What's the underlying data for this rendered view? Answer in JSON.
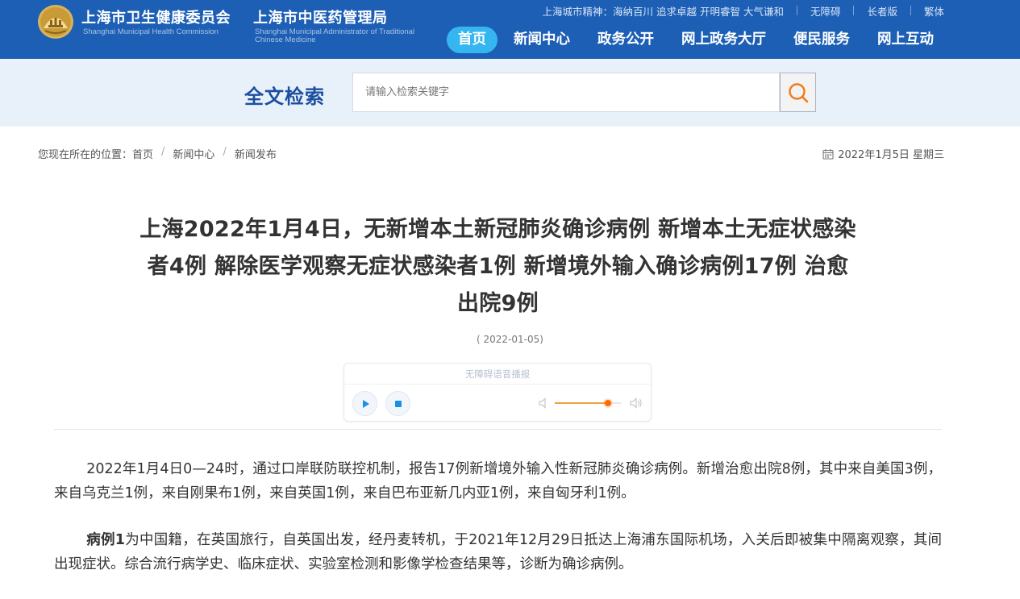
{
  "header": {
    "org1_cn": "上海市卫生健康委员会",
    "org1_en": "Shanghai Municipal Health Commission",
    "org2_cn": "上海市中医药管理局",
    "org2_en": "Shanghai Municipal Administrator of Traditional Chinese Medicine",
    "city_spirit": "上海城市精神：海纳百川 追求卓越 开明睿智 大气谦和",
    "accessibility": "无障碍",
    "elder_version": "长者版",
    "traditional": "繁体",
    "nav": [
      {
        "label": "首页"
      },
      {
        "label": "新闻中心"
      },
      {
        "label": "政务公开"
      },
      {
        "label": "网上政务大厅"
      },
      {
        "label": "便民服务"
      },
      {
        "label": "网上互动"
      }
    ]
  },
  "search": {
    "title": "全文检索",
    "placeholder": "请输入检索关键字",
    "button_icon": "search-icon"
  },
  "breadcrumb": {
    "prefix": "您现在所在的位置：",
    "items": [
      "首页",
      "新闻中心",
      "新闻发布"
    ]
  },
  "today": "2022年1月5日 星期三",
  "article": {
    "title": "上海2022年1月4日，无新增本土新冠肺炎确诊病例 新增本土无症状感染者4例 解除医学观察无症状感染者1例 新增境外输入确诊病例17例 治愈出院9例",
    "pubdate": "( 2022-01-05)",
    "para1": "2022年1月4日0—24时，通过口岸联防联控机制，报告17例新增境外输入性新冠肺炎确诊病例。新增治愈出院8例，其中来自美国3例，来自乌克兰1例，来自刚果布1例，来自英国1例，来自巴布亚新几内亚1例，来自匈牙利1例。",
    "para2_lead": "病例1",
    "para2_rest": "为中国籍，在英国旅行，自英国出发，经丹麦转机，于2021年12月29日抵达上海浦东国际机场，入关后即被集中隔离观察，其间出现症状。综合流行病学史、临床症状、实验室检测和影像学检查结果等，诊断为确诊病例。"
  },
  "player": {
    "label": "无障碍语音播报",
    "volume": 0.8,
    "accent": "#ff6a00"
  },
  "colors": {
    "header_bg": "#1d5fb5",
    "nav_active": "#36b6f0",
    "search_band": "#e8f1f9",
    "search_title": "#1c4fa0",
    "search_icon": "#f07a1a"
  }
}
